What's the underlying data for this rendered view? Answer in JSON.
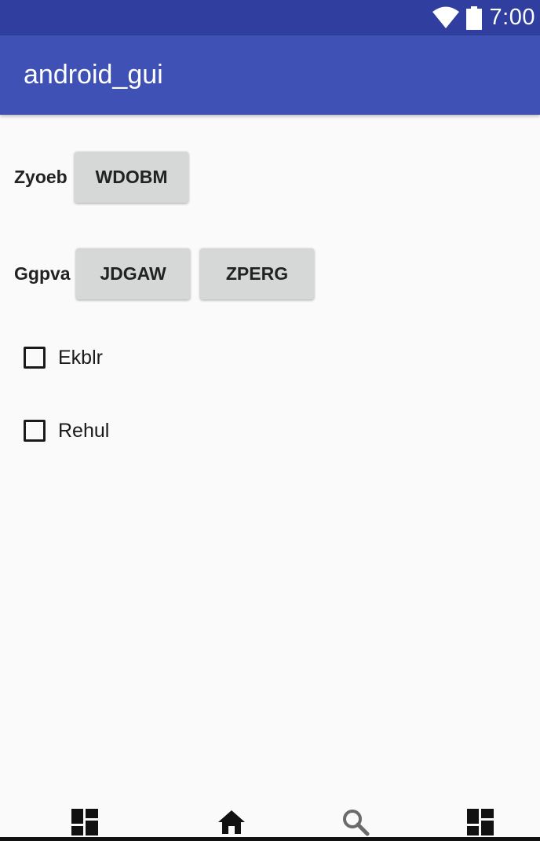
{
  "status_bar": {
    "time": "7:00",
    "icons": [
      "wifi-icon",
      "battery-icon"
    ],
    "color": "#303f9f"
  },
  "app_bar": {
    "title": "android_gui",
    "color": "#3f51b5"
  },
  "rows": [
    {
      "label": "Zyoeb",
      "buttons": [
        "WDOBM"
      ]
    },
    {
      "label": "Ggpva",
      "buttons": [
        "JDGAW",
        "ZPERG"
      ]
    }
  ],
  "checkboxes": [
    {
      "label": "Ekblr",
      "checked": false
    },
    {
      "label": "Rehul",
      "checked": false
    }
  ],
  "bottom_nav": {
    "items": [
      "dashboard-icon",
      "home-icon",
      "search-icon",
      "dashboard-icon"
    ]
  }
}
